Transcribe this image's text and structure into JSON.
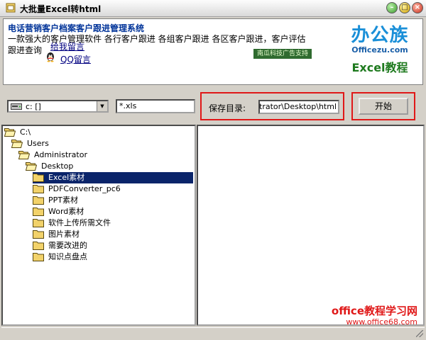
{
  "window": {
    "title": "大批量Excel转html"
  },
  "banner": {
    "headline": "电话营销客户档案客户跟进管理系统",
    "description": "一款强大的客户管理软件 各行客户跟进 各组客户跟进 各区客户跟进，客户评估跟进查询",
    "qq_link_top": "给我留言",
    "qq_link": "QQ留言",
    "ad_strip": "南瓜科技广告支持",
    "brand_main": "办公族",
    "brand_url": "Officezu.com",
    "brand_sub": "Excel教程"
  },
  "toolbar": {
    "drive_value": "c: []",
    "filter_value": "*.xls",
    "save_label": "保存目录:",
    "save_path": "C:\\Documents and Settings\\Administrator\\Desktop\\html",
    "start_label": "开始"
  },
  "tree": {
    "items": [
      {
        "label": "C:\\",
        "level": 0,
        "open": true,
        "selected": false
      },
      {
        "label": "Users",
        "level": 1,
        "open": true,
        "selected": false
      },
      {
        "label": "Administrator",
        "level": 2,
        "open": true,
        "selected": false
      },
      {
        "label": "Desktop",
        "level": 3,
        "open": true,
        "selected": false
      },
      {
        "label": "Excel素材",
        "level": 4,
        "open": false,
        "selected": true
      },
      {
        "label": "PDFConverter_pc6",
        "level": 4,
        "open": false,
        "selected": false
      },
      {
        "label": "PPT素材",
        "level": 4,
        "open": false,
        "selected": false
      },
      {
        "label": "Word素材",
        "level": 4,
        "open": false,
        "selected": false
      },
      {
        "label": "软件上传所需文件",
        "level": 4,
        "open": false,
        "selected": false
      },
      {
        "label": "图片素材",
        "level": 4,
        "open": false,
        "selected": false
      },
      {
        "label": "需要改进的",
        "level": 4,
        "open": false,
        "selected": false
      },
      {
        "label": "知识点盘点",
        "level": 4,
        "open": false,
        "selected": false
      }
    ]
  },
  "watermark": {
    "line1": "office教程学习网",
    "line2": "www.office68.com"
  },
  "colors": {
    "selection": "#0a246a",
    "highlight_frame": "#e01818",
    "headline": "#003399",
    "folder": "#f2d26a"
  }
}
